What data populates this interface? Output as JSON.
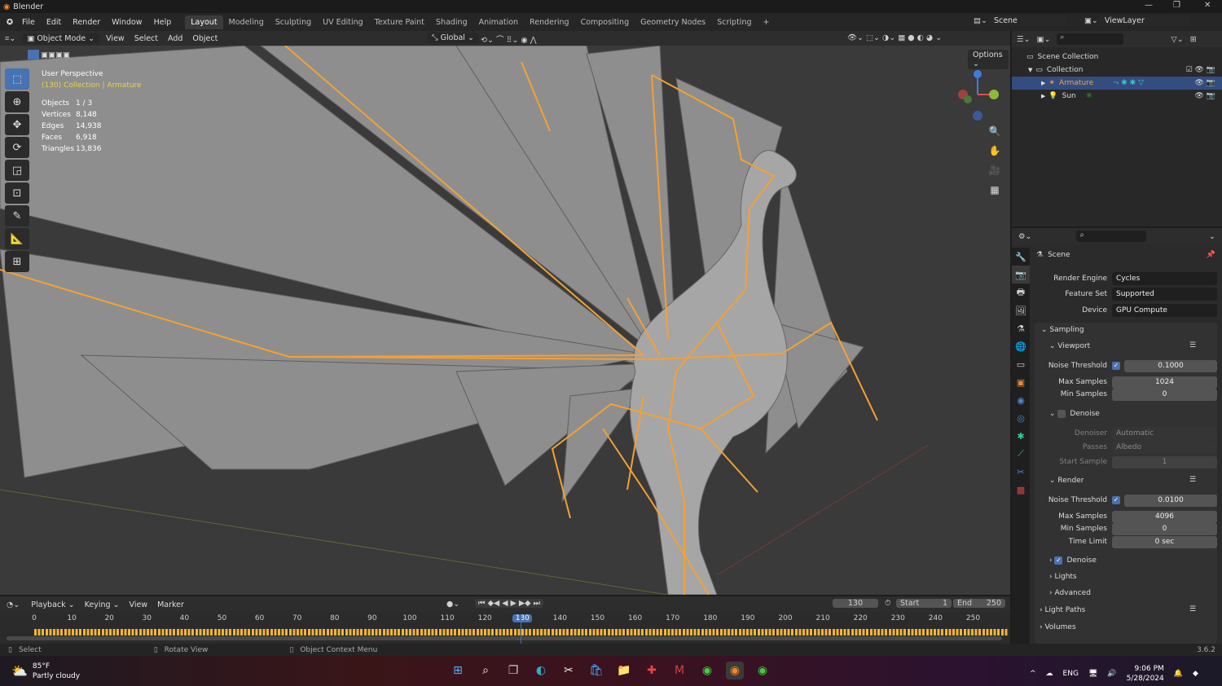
{
  "app": {
    "title": "Blender",
    "version": "3.6.2"
  },
  "menu": [
    "File",
    "Edit",
    "Render",
    "Window",
    "Help"
  ],
  "workspaces": [
    "Layout",
    "Modeling",
    "Sculpting",
    "UV Editing",
    "Texture Paint",
    "Shading",
    "Animation",
    "Rendering",
    "Compositing",
    "Geometry Nodes",
    "Scripting"
  ],
  "active_workspace": "Layout",
  "scene": {
    "name": "Scene",
    "view_layer": "ViewLayer"
  },
  "viewport_header": {
    "mode": "Object Mode",
    "items": [
      "View",
      "Select",
      "Add",
      "Object"
    ],
    "transform": "Global",
    "options": "Options"
  },
  "overlay": {
    "title": "User Perspective",
    "context": "(130) Collection | Armature",
    "stats": [
      {
        "label": "Objects",
        "value": "1 / 3"
      },
      {
        "label": "Vertices",
        "value": "8,148"
      },
      {
        "label": "Edges",
        "value": "14,938"
      },
      {
        "label": "Faces",
        "value": "6,918"
      },
      {
        "label": "Triangles",
        "value": "13,836"
      }
    ]
  },
  "outliner": {
    "items": [
      {
        "label": "Scene Collection"
      },
      {
        "label": "Collection"
      },
      {
        "label": "Armature",
        "selected": true
      },
      {
        "label": "Sun"
      }
    ]
  },
  "properties": {
    "header": "Scene",
    "render_engine": {
      "label": "Render Engine",
      "value": "Cycles"
    },
    "feature_set": {
      "label": "Feature Set",
      "value": "Supported"
    },
    "device": {
      "label": "Device",
      "value": "GPU Compute"
    },
    "sampling": "Sampling",
    "viewport": {
      "title": "Viewport",
      "noise_label": "Noise Threshold",
      "noise": "0.1000",
      "max_label": "Max Samples",
      "max": "1024",
      "min_label": "Min Samples",
      "min": "0",
      "denoise": "Denoise",
      "denoiser_label": "Denoiser",
      "denoiser": "Automatic",
      "passes_label": "Passes",
      "passes": "Albedo",
      "start_label": "Start Sample",
      "start": "1"
    },
    "render": {
      "title": "Render",
      "noise_label": "Noise Threshold",
      "noise": "0.0100",
      "max_label": "Max Samples",
      "max": "4096",
      "min_label": "Min Samples",
      "min": "0",
      "time_label": "Time Limit",
      "time": "0 sec",
      "denoise": "Denoise",
      "lights": "Lights",
      "advanced": "Advanced"
    },
    "light_paths": "Light Paths",
    "volumes": "Volumes"
  },
  "timeline": {
    "menus": [
      "Playback",
      "Keying",
      "View",
      "Marker"
    ],
    "current_frame": "130",
    "start_label": "Start",
    "start": "1",
    "end_label": "End",
    "end": "250",
    "ticks": [
      "0",
      "10",
      "20",
      "30",
      "40",
      "50",
      "60",
      "70",
      "80",
      "90",
      "100",
      "110",
      "120",
      "130",
      "140",
      "150",
      "160",
      "170",
      "180",
      "190",
      "200",
      "210",
      "220",
      "230",
      "240",
      "250"
    ]
  },
  "status": {
    "select": "Select",
    "rotate": "Rotate View",
    "context": "Object Context Menu"
  },
  "taskbar": {
    "temp": "85°F",
    "weather": "Partly cloudy",
    "lang": "ENG",
    "time": "9:06 PM",
    "date": "5/28/2024"
  },
  "colors": {
    "accent": "#4772b3",
    "bone": "#f5a033",
    "selection_text": "#e6d14a"
  }
}
